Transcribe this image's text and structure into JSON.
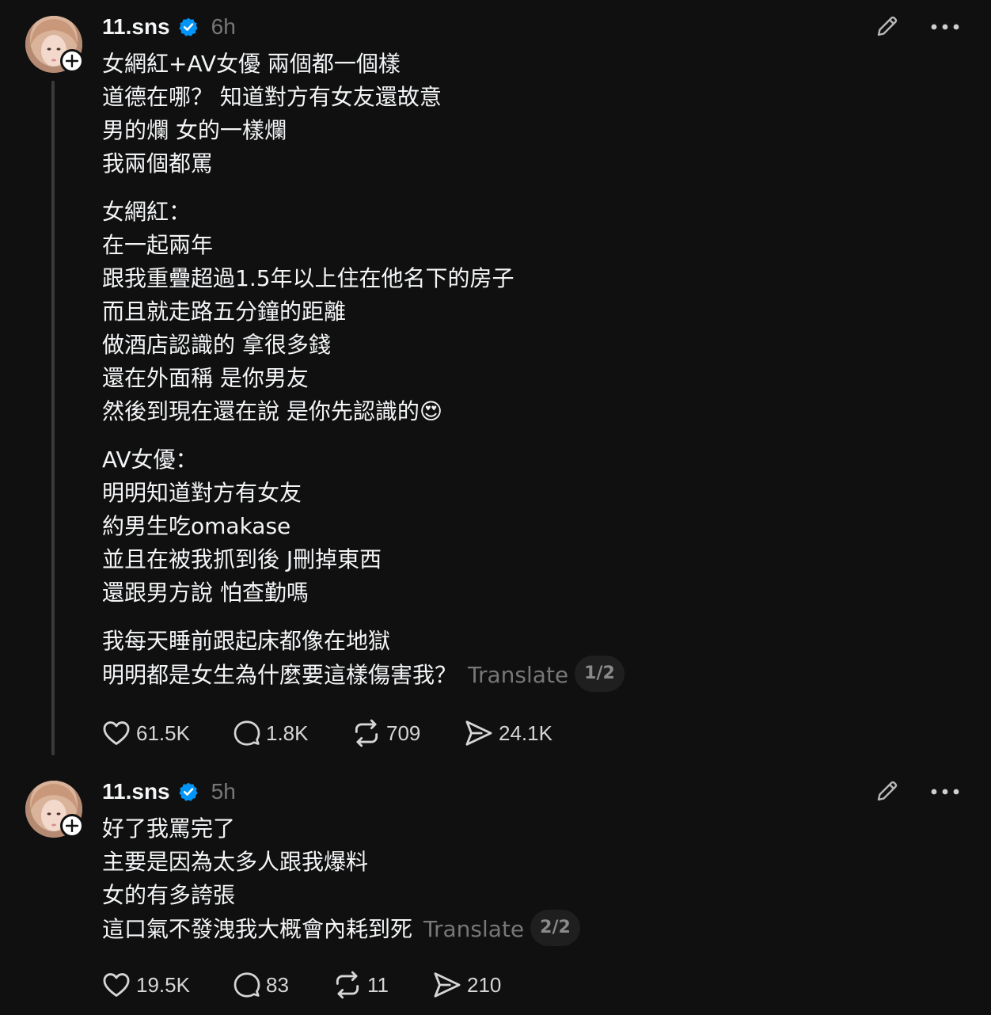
{
  "posts": [
    {
      "username": "11.sns",
      "verified": true,
      "time": "6h",
      "avatar_icon": "profile-photo",
      "follow_icon": "plus-icon",
      "body_lines": [
        "女網紅+AV女優 兩個都一個樣",
        "道德在哪？ 知道對方有女友還故意",
        "男的爛 女的一樣爛",
        "我兩個都罵",
        "",
        "女網紅：",
        "在一起兩年",
        "跟我重疊超過1.5年以上住在他名下的房子",
        "而且就走路五分鐘的距離",
        "做酒店認識的 拿很多錢",
        "還在外面稱 是你男友",
        "然後到現在還在說 是你先認識的😍",
        "",
        "AV女優：",
        "明明知道對方有女友",
        "約男生吃omakase",
        "並且在被我抓到後 J刪掉東西",
        "還跟男方說 怕查勤嗎",
        "",
        "我每天睡前跟起床都像在地獄",
        "明明都是女生為什麼要這樣傷害我？"
      ],
      "translate_label": "Translate",
      "page_indicator": "1/2",
      "likes": "61.5K",
      "replies": "1.8K",
      "reposts": "709",
      "shares": "24.1K"
    },
    {
      "username": "11.sns",
      "verified": true,
      "time": "5h",
      "avatar_icon": "profile-photo",
      "follow_icon": "plus-icon",
      "body_lines": [
        "好了我罵完了",
        "主要是因為太多人跟我爆料",
        "女的有多誇張",
        "這口氣不發洩我大概會內耗到死"
      ],
      "translate_label": "Translate",
      "page_indicator": "2/2",
      "likes": "19.5K",
      "replies": "83",
      "reposts": "11",
      "shares": "210"
    }
  ],
  "colors": {
    "background": "#101010",
    "text": "#f3f5f7",
    "muted": "#777777",
    "verified": "#0095f6",
    "thread_line": "#3a3a3a"
  },
  "icons": {
    "edit": "pencil-icon",
    "more": "more-horizontal-icon",
    "like": "heart-icon",
    "reply": "comment-icon",
    "repost": "repost-icon",
    "share": "send-icon",
    "verified": "verified-badge-icon"
  }
}
